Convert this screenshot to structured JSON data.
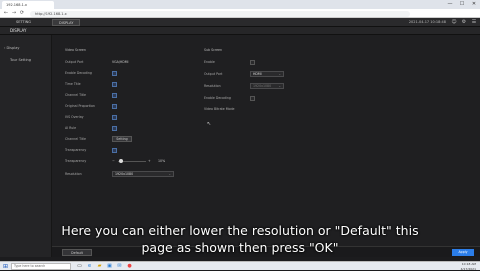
{
  "browser": {
    "tab_title": "192.168.1.x",
    "url": "http://192.168.1.x",
    "controls": {
      "minimize": "—",
      "maximize": "☐",
      "close": "✕"
    },
    "nav": {
      "back": "←",
      "forward": "→",
      "reload": "⟳"
    }
  },
  "app_header": {
    "tabs": [
      {
        "label": "SETTING"
      },
      {
        "label": "DISPLAY"
      }
    ],
    "datetime": "2021-04-17 10:18:48",
    "icons": [
      "user-icon",
      "gear-icon",
      "menu-icon"
    ]
  },
  "page_title": "DISPLAY",
  "sidebar": {
    "items": [
      {
        "label": "‹ Display"
      },
      {
        "label": "Tour Setting"
      }
    ]
  },
  "left_panel": {
    "heading": "Video Screen",
    "rows": [
      {
        "label": "Output Port",
        "value": "VGA/HDMI"
      },
      {
        "label": "Enable Decoding",
        "checked": true
      },
      {
        "label": "Time Title",
        "checked": true
      },
      {
        "label": "Channel Title",
        "checked": true
      },
      {
        "label": "Original Proportion",
        "checked": true
      },
      {
        "label": "IVS Overlay",
        "checked": true
      },
      {
        "label": "AI Rule",
        "checked": true
      },
      {
        "label": "Channel Title",
        "button": "Setting"
      },
      {
        "label": "Transparency",
        "slider": 10,
        "unit": "%"
      },
      {
        "label": "Resolution",
        "value": "1920x1080"
      }
    ],
    "transparency_label": "Transparency",
    "transparency_minus": "−",
    "transparency_plus": "+"
  },
  "right_panel": {
    "heading": "Sub Screen",
    "rows": [
      {
        "label": "Enable",
        "checked": false
      },
      {
        "label": "Output Port",
        "value": "HDMI"
      },
      {
        "label": "Resolution",
        "value": "1920x1080"
      },
      {
        "label": "Enable Decoding",
        "checked": false
      },
      {
        "label": "Video Bitrate Mode"
      }
    ]
  },
  "footer": {
    "default_label": "Default",
    "apply_label": "Apply"
  },
  "caption": {
    "line1": "Here you can either lower the resolution or \"Default\" this",
    "line2": "page as shown then press \"OK\""
  },
  "taskbar": {
    "search_placeholder": "Type here to search",
    "time": "10:18 AM",
    "date": "4/17/2021"
  },
  "colors": {
    "accent": "#2b7de9",
    "checkbox": "#4a6fa5"
  }
}
